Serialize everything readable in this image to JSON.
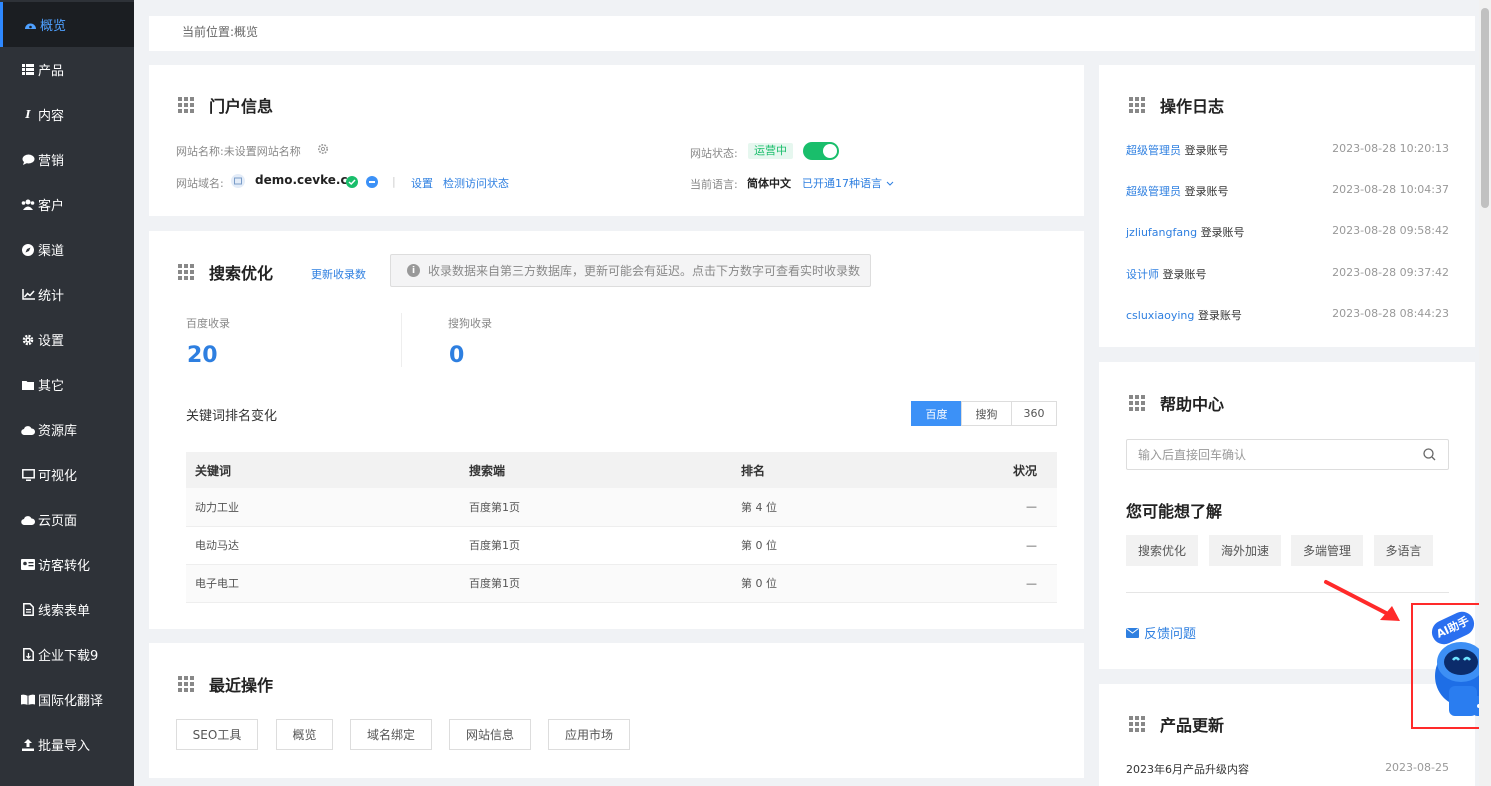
{
  "sidebar": {
    "items": [
      {
        "label": "概览",
        "icon": "dashboard-icon"
      },
      {
        "label": "产品",
        "icon": "list-icon"
      },
      {
        "label": "内容",
        "icon": "italic-icon"
      },
      {
        "label": "营销",
        "icon": "chat-icon"
      },
      {
        "label": "客户",
        "icon": "users-icon"
      },
      {
        "label": "渠道",
        "icon": "compass-icon"
      },
      {
        "label": "统计",
        "icon": "line-chart-icon"
      },
      {
        "label": "设置",
        "icon": "gear-icon"
      },
      {
        "label": "其它",
        "icon": "folder-icon"
      },
      {
        "label": "资源库",
        "icon": "cloud-icon"
      },
      {
        "label": "可视化",
        "icon": "monitor-icon"
      },
      {
        "label": "云页面",
        "icon": "cloud-icon"
      },
      {
        "label": "访客转化",
        "icon": "id-card-icon"
      },
      {
        "label": "线索表单",
        "icon": "form-icon"
      },
      {
        "label": "企业下载9",
        "icon": "download-file-icon"
      },
      {
        "label": "国际化翻译",
        "icon": "book-icon"
      },
      {
        "label": "批量导入",
        "icon": "upload-icon"
      }
    ]
  },
  "breadcrumb": {
    "prefix": "当前位置:",
    "current": "概览"
  },
  "portal": {
    "title": "门户信息",
    "site_name_label": "网站名称:",
    "site_name_value": "未设置网站名称",
    "site_domain_label": "网站域名:",
    "domain": "demo.cevke.cn",
    "set_link": "设置",
    "check_link": "检测访问状态",
    "status_label": "网站状态:",
    "status_value": "运营中",
    "lang_label": "当前语言:",
    "lang_value": "简体中文",
    "lang_more": "已开通17种语言"
  },
  "seo": {
    "title": "搜索优化",
    "update_link": "更新收录数",
    "notice": "收录数据来自第三方数据库，更新可能会有延迟。点击下方数字可查看实时收录数",
    "baidu_label": "百度收录",
    "baidu_value": "20",
    "sogou_label": "搜狗收录",
    "sogou_value": "0",
    "ranking_title": "关键词排名变化",
    "engines": [
      "百度",
      "搜狗",
      "360"
    ],
    "table": {
      "headers": [
        "关键词",
        "搜索端",
        "排名",
        "状况"
      ],
      "rows": [
        [
          "动力工业",
          "百度第1页",
          "第 4 位",
          "—"
        ],
        [
          "电动马达",
          "百度第1页",
          "第 0 位",
          "—"
        ],
        [
          "电子电工",
          "百度第1页",
          "第 0 位",
          "—"
        ]
      ]
    }
  },
  "recent": {
    "title": "最近操作",
    "buttons": [
      "SEO工具",
      "概览",
      "域名绑定",
      "网站信息",
      "应用市场"
    ]
  },
  "oplog": {
    "title": "操作日志",
    "rows": [
      {
        "user": "超级管理员",
        "action": "登录账号",
        "time": "2023-08-28 10:20:13"
      },
      {
        "user": "超级管理员",
        "action": "登录账号",
        "time": "2023-08-28 10:04:37"
      },
      {
        "user": "jzliufangfang",
        "action": "登录账号",
        "time": "2023-08-28 09:58:42"
      },
      {
        "user": "设计师",
        "action": "登录账号",
        "time": "2023-08-28 09:37:42"
      },
      {
        "user": "csluxiaoying",
        "action": "登录账号",
        "time": "2023-08-28 08:44:23"
      }
    ]
  },
  "help": {
    "title": "帮助中心",
    "search_placeholder": "输入后直接回车确认",
    "subtitle": "您可能想了解",
    "tags": [
      "搜索优化",
      "海外加速",
      "多端管理",
      "多语言"
    ],
    "feedback": "反馈问题"
  },
  "updates": {
    "title": "产品更新",
    "rows": [
      {
        "name": "2023年6月产品升级内容",
        "date": "2023-08-25"
      }
    ]
  },
  "assistant": {
    "label": "AI助手"
  },
  "colors": {
    "accent": "#2e7fe0",
    "sidebar": "#2e3238",
    "success": "#19be6b",
    "highlight": "#ff2a2a"
  }
}
